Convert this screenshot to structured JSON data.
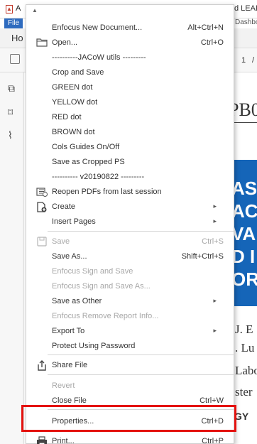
{
  "window": {
    "app_letter": "A",
    "title_fragment": "d LEAF -",
    "file_tab": "File",
    "dashboard_fragment": "Dashboa",
    "home_tab": "Ho",
    "page_number": "1",
    "page_sep": "/"
  },
  "document": {
    "pb_text": "PB0",
    "blue_lines": [
      "AS",
      "AC",
      "VA",
      "D I",
      "OR"
    ],
    "text_lines": [
      "J. E",
      ". Lu",
      "Labo",
      "ster"
    ],
    "logo_text": "GY"
  },
  "menu": {
    "items": [
      {
        "label": "Enfocus New Document...",
        "shortcut": "Alt+Ctrl+N",
        "disabled": false
      },
      {
        "label": "Open...",
        "shortcut": "Ctrl+O",
        "icon": "folder-icon",
        "disabled": false
      },
      {
        "label": "----------JACoW utils ---------",
        "disabled": false
      },
      {
        "label": "Crop and Save",
        "disabled": false
      },
      {
        "label": "GREEN dot",
        "disabled": false
      },
      {
        "label": "YELLOW dot",
        "disabled": false
      },
      {
        "label": "RED dot",
        "disabled": false
      },
      {
        "label": "BROWN dot",
        "disabled": false
      },
      {
        "label": "Cols Guides On/Off",
        "disabled": false
      },
      {
        "label": "Save as Cropped PS",
        "disabled": false
      },
      {
        "label": "---------- v20190822 ---------",
        "disabled": false
      },
      {
        "label": "Reopen PDFs from last session",
        "icon": "reopen-icon",
        "disabled": false
      },
      {
        "label": "Create",
        "icon": "create-icon",
        "submenu": true,
        "disabled": false
      },
      {
        "label": "Insert Pages",
        "submenu": true,
        "disabled": false
      },
      {
        "label": "Save",
        "shortcut": "Ctrl+S",
        "icon": "save-icon",
        "disabled": true
      },
      {
        "label": "Save As...",
        "shortcut": "Shift+Ctrl+S",
        "disabled": false
      },
      {
        "label": "Enfocus Sign and Save",
        "disabled": true
      },
      {
        "label": "Enfocus Sign and Save As...",
        "disabled": true
      },
      {
        "label": "Save as Other",
        "submenu": true,
        "disabled": false
      },
      {
        "label": "Enfocus Remove Report Info...",
        "disabled": true
      },
      {
        "label": "Export To",
        "submenu": true,
        "disabled": false
      },
      {
        "label": "Protect Using Password",
        "disabled": false
      },
      {
        "label": "Share File",
        "icon": "share-icon",
        "disabled": false
      },
      {
        "label": "Revert",
        "disabled": true
      },
      {
        "label": "Close File",
        "shortcut": "Ctrl+W",
        "disabled": false
      },
      {
        "label": "Properties...",
        "shortcut": "Ctrl+D",
        "disabled": false
      },
      {
        "label": "Print...",
        "shortcut": "Ctrl+P",
        "icon": "print-icon",
        "disabled": false
      }
    ]
  },
  "colors": {
    "highlight": "#e4120f",
    "file_tab": "#2e6bbf",
    "doc_banner": "#1565b8"
  }
}
